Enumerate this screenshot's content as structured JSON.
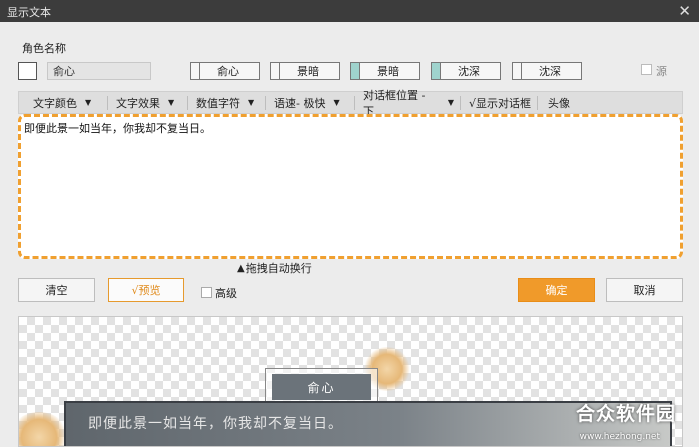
{
  "window": {
    "title": "显示文本",
    "close_glyph": "✕"
  },
  "role": {
    "label": "角色名称",
    "swatch_color": "#ffffff",
    "name_value": "俞心",
    "presets": [
      {
        "label": "俞心",
        "style": "plain"
      },
      {
        "label": "景暗",
        "style": "plain"
      },
      {
        "label": "景暗",
        "style": "teal"
      },
      {
        "label": "沈深",
        "style": "teal"
      },
      {
        "label": "沈深",
        "style": "plain"
      }
    ],
    "source_checkbox_label": "源",
    "source_checked": false
  },
  "toolbar": {
    "text_color": "文字颜色",
    "text_effect": "文字效果",
    "numeric_char": "数值字符",
    "speed": "语速- 极快",
    "dialog_position": "对话框位置 - 下",
    "show_dialog": "√显示对话框",
    "avatar": "头像",
    "caret_glyph": "▼"
  },
  "editor": {
    "content": "即便此景一如当年，你我却不复当日。",
    "drag_hint": "拖拽自动换行",
    "drag_glyph": "▲"
  },
  "actions": {
    "clear": "清空",
    "preview": "√预览",
    "advanced_label": "高级",
    "advanced_checked": false,
    "confirm": "确定",
    "cancel": "取消"
  },
  "preview": {
    "speaker_name": "俞心",
    "dialog_text": "即便此景一如当年，你我却不复当日。"
  },
  "watermark": {
    "logo_text": "合众软件园",
    "url": "www.hezhong.net"
  },
  "colors": {
    "accent": "#f09a2a",
    "dashed_border": "#f0a030",
    "teal": "#9fd3cd",
    "titlebar": "#3c3c3c"
  }
}
